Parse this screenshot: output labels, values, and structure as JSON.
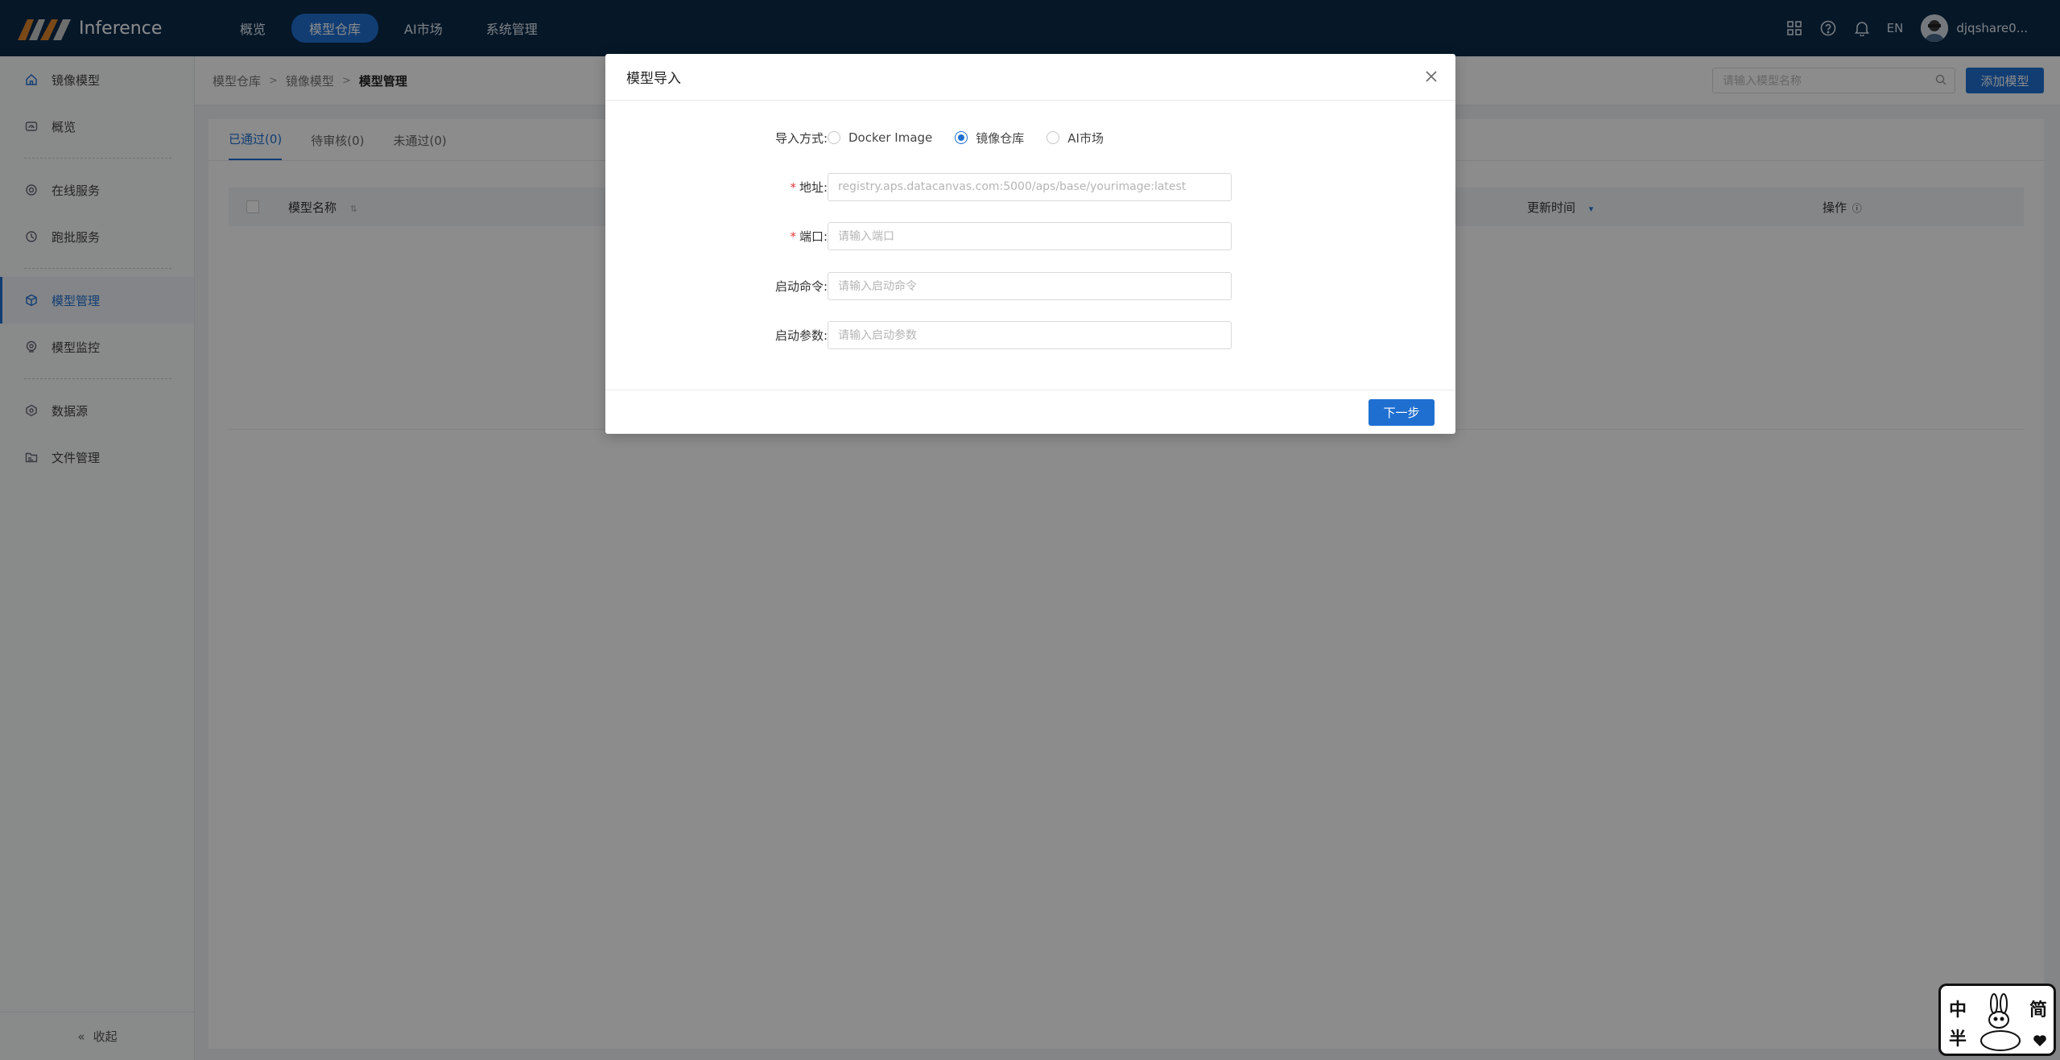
{
  "app": {
    "name": "Inference"
  },
  "topnav": {
    "items": [
      {
        "label": "概览",
        "active": false
      },
      {
        "label": "模型仓库",
        "active": true
      },
      {
        "label": "AI市场",
        "active": false
      },
      {
        "label": "系统管理",
        "active": false
      }
    ],
    "lang": "EN",
    "username": "djqshare0..."
  },
  "sidebar": {
    "items": [
      {
        "label": "镜像模型",
        "icon": "home-icon"
      },
      {
        "label": "概览",
        "icon": "dashboard-icon"
      },
      {
        "label": "在线服务",
        "icon": "online-service-icon"
      },
      {
        "label": "跑批服务",
        "icon": "batch-service-icon"
      },
      {
        "label": "模型管理",
        "icon": "cube-icon",
        "active": true
      },
      {
        "label": "模型监控",
        "icon": "monitor-icon"
      },
      {
        "label": "数据源",
        "icon": "datasource-icon"
      },
      {
        "label": "文件管理",
        "icon": "folder-icon"
      }
    ],
    "collapse_label": "收起"
  },
  "breadcrumb": [
    "模型仓库",
    "镜像模型",
    "模型管理"
  ],
  "search": {
    "placeholder": "请输入模型名称"
  },
  "add_button": "添加模型",
  "tabs": [
    {
      "label": "已通过(0)",
      "active": true
    },
    {
      "label": "待审核(0)",
      "active": false
    },
    {
      "label": "未通过(0)",
      "active": false
    }
  ],
  "table": {
    "columns": {
      "name": "模型名称",
      "updated": "更新时间",
      "actions": "操作"
    }
  },
  "modal": {
    "title": "模型导入",
    "import_label": "导入方式:",
    "import_options": [
      {
        "label": "Docker Image",
        "checked": false
      },
      {
        "label": "镜像仓库",
        "checked": true
      },
      {
        "label": "AI市场",
        "checked": false
      }
    ],
    "address": {
      "label": "地址:",
      "placeholder": "registry.aps.datacanvas.com:5000/aps/base/yourimage:latest"
    },
    "port": {
      "label": "端口:",
      "placeholder": "请输入端口"
    },
    "command": {
      "label": "启动命令:",
      "placeholder": "请输入启动命令"
    },
    "params": {
      "label": "启动参数:",
      "placeholder": "请输入启动参数"
    },
    "next_button": "下一步"
  },
  "sticker": {
    "chars": [
      "中",
      "半",
      "简"
    ]
  },
  "colors": {
    "topbar": "#0b2a4a",
    "accent": "#1f6fd1",
    "required": "#e23b3b"
  }
}
